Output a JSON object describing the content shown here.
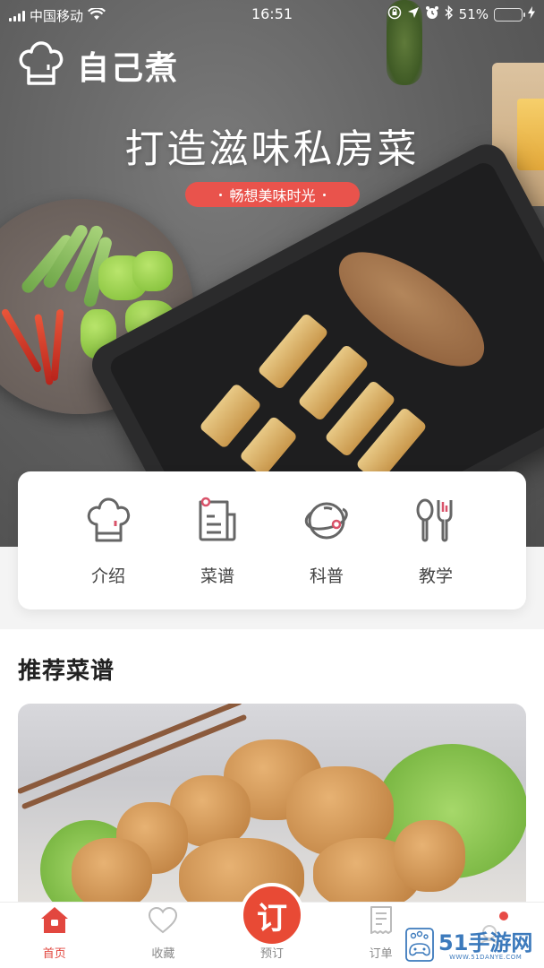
{
  "status_bar": {
    "carrier": "中国移动",
    "time": "16:51",
    "battery_percent": "51%",
    "battery_level": 0.51
  },
  "brand": {
    "name": "自己煮",
    "icon": "chef-hat-icon"
  },
  "hero": {
    "title": "打造滋味私房菜",
    "badge": "畅想美味时光"
  },
  "categories": [
    {
      "label": "介绍",
      "icon": "chef-hat-icon"
    },
    {
      "label": "菜谱",
      "icon": "recipe-document-icon"
    },
    {
      "label": "科普",
      "icon": "planet-icon"
    },
    {
      "label": "教学",
      "icon": "spoon-fork-icon"
    }
  ],
  "recommended": {
    "title": "推荐菜谱"
  },
  "tab_bar": {
    "items": [
      {
        "label": "首页",
        "icon": "home-icon",
        "active": true
      },
      {
        "label": "收藏",
        "icon": "heart-icon",
        "active": false
      },
      {
        "label": "预订",
        "icon": "reserve-button",
        "center_glyph": "订",
        "active": false
      },
      {
        "label": "订单",
        "icon": "receipt-icon",
        "active": false
      },
      {
        "label": "",
        "icon": "profile-icon",
        "active": false,
        "has_notification": true
      }
    ]
  },
  "watermark": {
    "text": "51手游网",
    "sub": "WWW.51DANYE.COM"
  },
  "colors": {
    "accent": "#e84a35",
    "badge": "#e9534c",
    "icon_stroke": "#666666",
    "icon_accent": "#d9536a",
    "battery": "#5ed35a"
  }
}
